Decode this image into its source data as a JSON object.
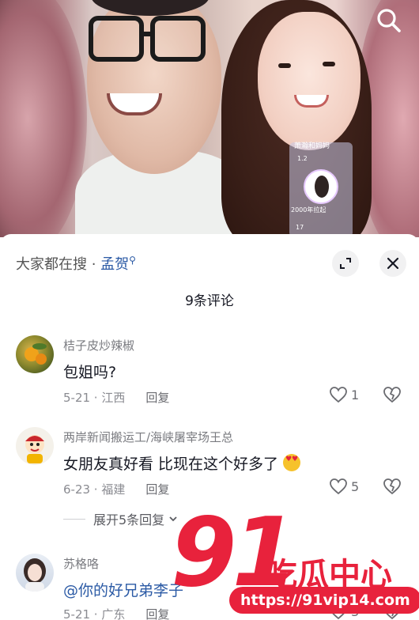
{
  "video": {
    "sticker_title": "萧瀚和妈妈",
    "sticker_count_top": "1.2",
    "sticker_sub": "2000年拉起",
    "sticker_count_bottom": "17"
  },
  "header": {
    "trending_prefix": "大家都在搜 · ",
    "trending_keyword": "孟贺",
    "comment_count": "9条评论"
  },
  "comments": [
    {
      "username": "桔子皮炒辣椒",
      "text": "包姐吗?",
      "date_location": "5-21 · 江西",
      "reply_label": "回复",
      "likes": "1"
    },
    {
      "username": "两岸新闻搬运工/海峡屠宰场王总",
      "text": "女朋友真好看 比现在这个好多了",
      "emoji": "heart-eyes-emoji",
      "date_location": "6-23 · 福建",
      "reply_label": "回复",
      "likes": "5"
    },
    {
      "username": "苏格咯",
      "text": "@你的好兄弟李子",
      "date_location": "5-21 · 广东",
      "reply_label": "回复",
      "likes": "3"
    }
  ],
  "expand_replies": "展开5条回复",
  "watermark": {
    "number": "91",
    "name": "吃瓜中心",
    "url": "https://91vip14.com"
  },
  "colors": {
    "accent_blue": "#2b5aa5",
    "watermark_red": "#e8223c"
  }
}
